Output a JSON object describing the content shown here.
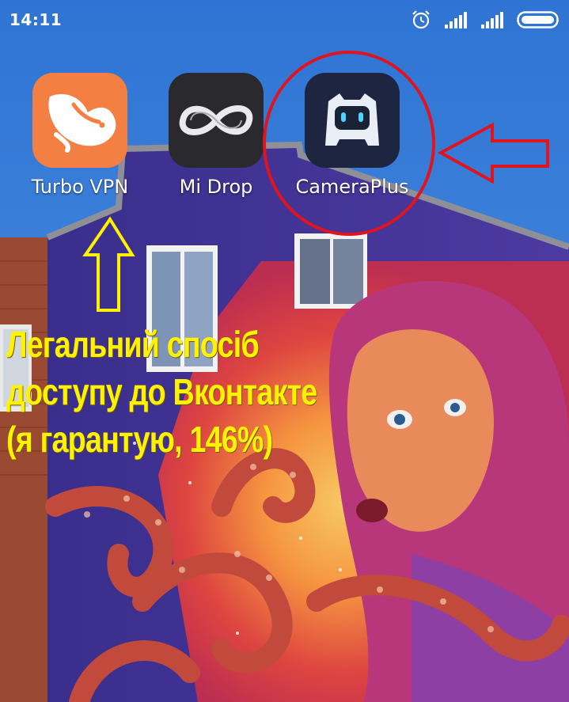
{
  "status_bar": {
    "time": "14:11",
    "icons": [
      "alarm-icon",
      "signal-icon",
      "signal-icon",
      "battery-icon"
    ]
  },
  "apps": [
    {
      "label": "Turbo VPN",
      "icon": "rabbit-icon",
      "bg": "#f47f43"
    },
    {
      "label": "Mi Drop",
      "icon": "infinity-loop-icon",
      "bg": "#2a2a2e"
    },
    {
      "label": "CameraPlus",
      "icon": "robot-icon",
      "bg": "#1e2540"
    }
  ],
  "caption": {
    "line1": "Легальний спосіб",
    "line2": "доступу до Вконтакте",
    "line3": "(я гарантую, 146%)"
  },
  "annotations": {
    "circle_color": "#e0141e",
    "arrow_red_color": "#e0141e",
    "arrow_yellow_color": "#fff200",
    "caption_color": "#fff200"
  }
}
